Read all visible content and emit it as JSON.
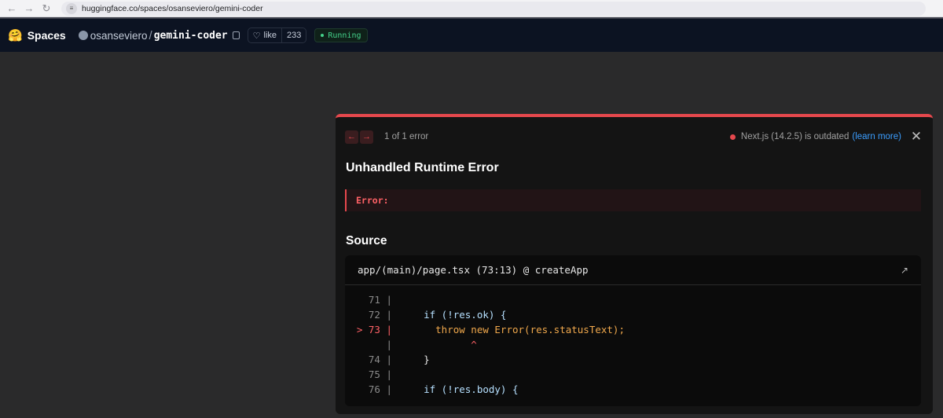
{
  "browser": {
    "url_host": "huggingface.co",
    "url_path": "/spaces/osanseviero/gemini-coder"
  },
  "hf": {
    "logo": "🤗",
    "spaces_label": "Spaces",
    "owner": "osanseviero",
    "separator": "/",
    "repo": "gemini-coder",
    "like_label": "like",
    "like_count": "233",
    "status": "Running"
  },
  "error": {
    "counter": "1 of 1 error",
    "version_text": "Next.js (14.2.5) is outdated",
    "learn_more": "(learn more)",
    "title": "Unhandled Runtime Error",
    "message": "Error:",
    "source_title": "Source",
    "file": "app/(main)/page.tsx (73:13) @ createApp",
    "code_lines": [
      {
        "gutter": "71 |",
        "text": ""
      },
      {
        "gutter": "72 |",
        "text": "    if (!res.ok) {"
      },
      {
        "gutter": "> 73 |",
        "text": "      throw new Error(res.statusText);"
      },
      {
        "gutter": "|",
        "text": "            ^"
      },
      {
        "gutter": "74 |",
        "text": "    }"
      },
      {
        "gutter": "75 |",
        "text": ""
      },
      {
        "gutter": "76 |",
        "text": "    if (!res.body) {"
      }
    ]
  },
  "colors": {
    "error_red": "#e5484d",
    "link_blue": "#3b9eff",
    "running_green": "#44d18a",
    "header_bg": "#0c1322"
  }
}
